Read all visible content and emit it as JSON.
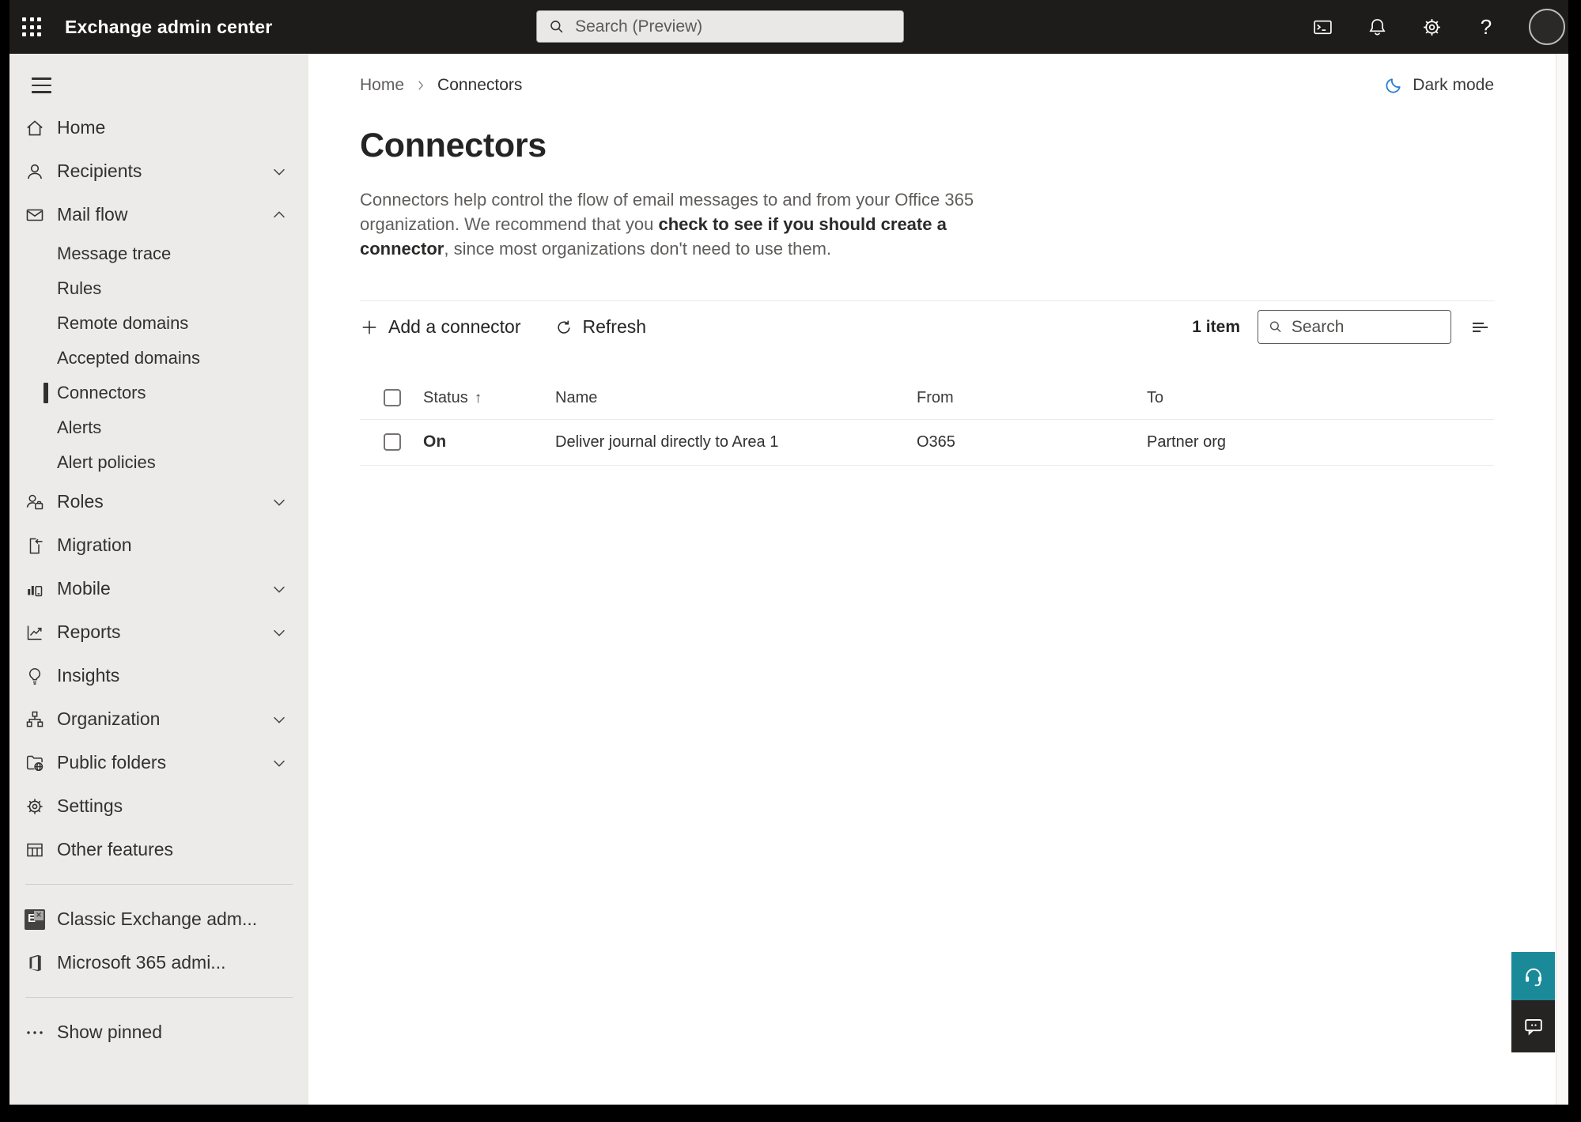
{
  "topbar": {
    "title": "Exchange admin center",
    "search_placeholder": "Search (Preview)"
  },
  "breadcrumb": {
    "home": "Home",
    "current": "Connectors"
  },
  "dark_mode_label": "Dark mode",
  "sidebar": {
    "items": [
      {
        "label": "Home"
      },
      {
        "label": "Recipients"
      },
      {
        "label": "Mail flow"
      },
      {
        "label": "Roles"
      },
      {
        "label": "Migration"
      },
      {
        "label": "Mobile"
      },
      {
        "label": "Reports"
      },
      {
        "label": "Insights"
      },
      {
        "label": "Organization"
      },
      {
        "label": "Public folders"
      },
      {
        "label": "Settings"
      },
      {
        "label": "Other features"
      }
    ],
    "mail_flow_children": [
      "Message trace",
      "Rules",
      "Remote domains",
      "Accepted domains",
      "Connectors",
      "Alerts",
      "Alert policies"
    ],
    "footer": [
      "Classic Exchange adm...",
      "Microsoft 365 admi...",
      "Show pinned"
    ]
  },
  "page": {
    "title": "Connectors",
    "description_pre": "Connectors help control the flow of email messages to and from your Office 365 organization. We recommend that you ",
    "description_link": "check to see if you should create a connector",
    "description_post": ", since most organizations don't need to use them."
  },
  "toolbar": {
    "add_label": "Add a connector",
    "refresh_label": "Refresh",
    "item_count": "1 item",
    "search_placeholder": "Search"
  },
  "table": {
    "headers": {
      "status": "Status",
      "name": "Name",
      "from": "From",
      "to": "To"
    },
    "rows": [
      {
        "status": "On",
        "name": "Deliver journal directly to Area 1",
        "from": "O365",
        "to": "Partner org"
      }
    ]
  },
  "colors": {
    "topbar_bg": "#1d1c1b",
    "sidebar_bg": "#ecebe9",
    "teal_help": "#1a8a99",
    "moon_blue": "#2b7cd3"
  }
}
